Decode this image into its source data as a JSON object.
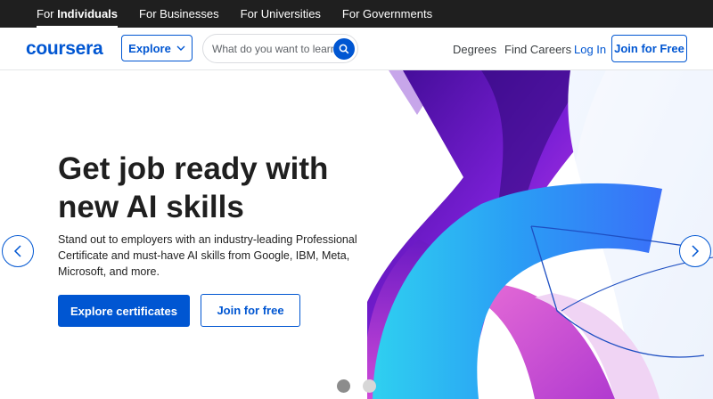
{
  "audience_bar": {
    "items": [
      {
        "prefix": "For ",
        "label": "Individuals",
        "active": true
      },
      {
        "prefix": "",
        "label": "For Businesses",
        "active": false
      },
      {
        "prefix": "",
        "label": "For Universities",
        "active": false
      },
      {
        "prefix": "",
        "label": "For Governments",
        "active": false
      }
    ]
  },
  "header": {
    "logo": "coursera",
    "explore_label": "Explore",
    "search_placeholder": "What do you want to learn?",
    "links": [
      "Degrees",
      "Find Careers"
    ],
    "login_label": "Log In",
    "join_label": "Join for Free"
  },
  "hero": {
    "title": "Get job ready with new AI skills",
    "description": "Stand out to employers with an industry-leading Professional Certificate and must-have AI skills from Google, IBM, Meta, Microsoft, and more.",
    "primary_cta": "Explore certificates",
    "secondary_cta": "Join for free"
  },
  "carousel": {
    "slide_count": 2,
    "active_slide": 1
  },
  "colors": {
    "brand": "#0056d2",
    "topbar": "#1f1f1f",
    "text": "#1f1f1f"
  },
  "icons": {
    "explore_chevron": "chevron-down-icon",
    "search": "search-icon",
    "prev": "chevron-left-icon",
    "next": "chevron-right-icon"
  }
}
